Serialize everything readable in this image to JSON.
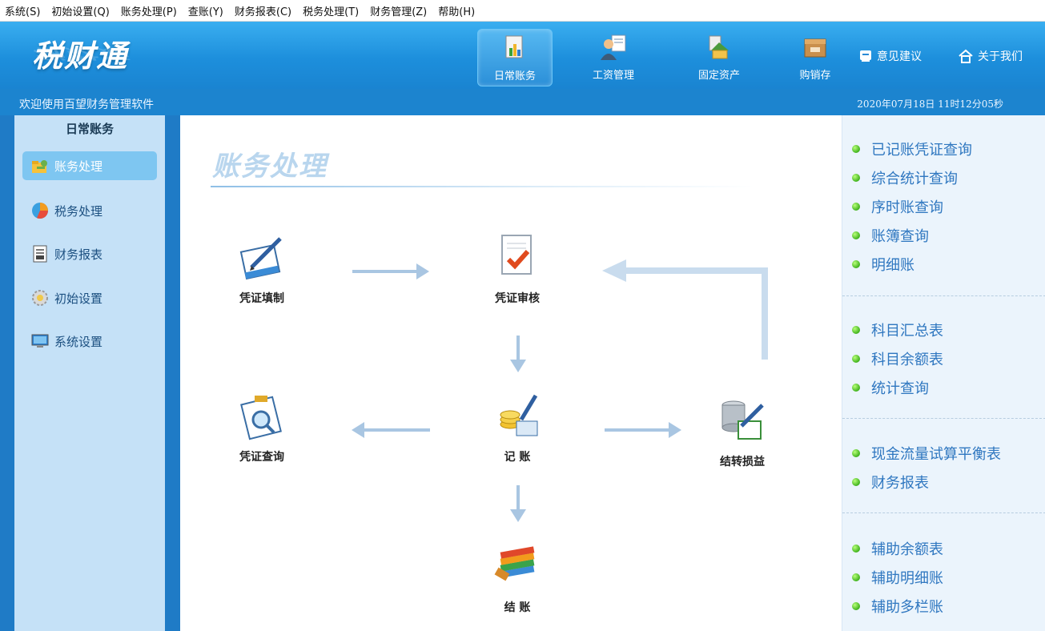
{
  "menubar": [
    "系统(S)",
    "初始设置(Q)",
    "账务处理(P)",
    "查账(Y)",
    "财务报表(C)",
    "税务处理(T)",
    "财务管理(Z)",
    "帮助(H)"
  ],
  "app": {
    "logo": "税财通"
  },
  "topnav": [
    {
      "label": "日常账务",
      "icon": "ledger-chart-icon"
    },
    {
      "label": "工资管理",
      "icon": "payroll-person-icon"
    },
    {
      "label": "固定资产",
      "icon": "fixed-asset-icon"
    },
    {
      "label": "购销存",
      "icon": "inventory-box-icon"
    }
  ],
  "toplinks": {
    "feedback": "意见建议",
    "about": "关于我们"
  },
  "subbar": {
    "welcome": "欢迎使用百望财务管理软件",
    "datetime": "2020年07月18日 11时12分05秒"
  },
  "sidebar": {
    "title": "日常账务",
    "items": [
      {
        "label": "账务处理",
        "icon": "folder-key-icon"
      },
      {
        "label": "税务处理",
        "icon": "pie-chart-icon"
      },
      {
        "label": "财务报表",
        "icon": "report-doc-icon"
      },
      {
        "label": "初始设置",
        "icon": "gear-icon"
      },
      {
        "label": "系统设置",
        "icon": "monitor-icon"
      }
    ]
  },
  "main": {
    "title": "账务处理",
    "nodes": {
      "voucher_entry": "凭证填制",
      "voucher_review": "凭证审核",
      "voucher_query": "凭证查询",
      "posting": "记  账",
      "carry_forward": "结转损益",
      "closing": "结  账"
    }
  },
  "rightpanel": {
    "groups": [
      [
        "已记账凭证查询",
        "综合统计查询",
        "序时账查询",
        "账簿查询",
        "明细账"
      ],
      [
        "科目汇总表",
        "科目余额表",
        "统计查询"
      ],
      [
        "现金流量试算平衡表",
        "财务报表"
      ],
      [
        "辅助余额表",
        "辅助明细账",
        "辅助多栏账"
      ]
    ]
  }
}
